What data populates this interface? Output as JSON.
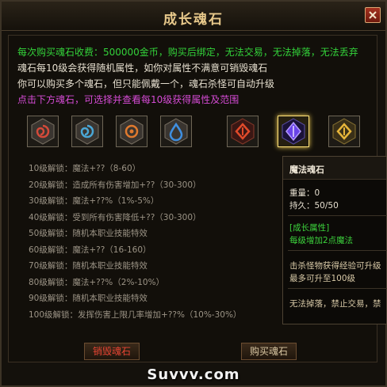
{
  "window": {
    "title": "成长魂石"
  },
  "info": {
    "line1": "每次购买魂石收费：500000金币，购买后绑定，无法交易，无法掉落，无法丢弃",
    "line2": "魂石每10级会获得随机属性，如你对属性不满意可销毁魂石",
    "line3": "你可以购买多个魂石，但只能佩戴一个，魂石杀怪可自动升级",
    "line4": "点击下方魂石，可选择并查看每10级获得属性及范围"
  },
  "stones": [
    {
      "icon": "red-swirl-rune-icon",
      "color": "#d44a3a"
    },
    {
      "icon": "blue-swirl-rune-icon",
      "color": "#4aa7d6"
    },
    {
      "icon": "orange-flame-rune-icon",
      "color": "#e07a2e"
    },
    {
      "icon": "blue-water-rune-icon",
      "color": "#3f8fe0"
    },
    {
      "icon": "red-crystal-rune-icon",
      "color": "#e04a2a"
    },
    {
      "icon": "purple-crystal-rune-icon",
      "color": "#8a5cff",
      "selected": true
    },
    {
      "icon": "gold-crystal-rune-icon",
      "color": "#e6b53a"
    }
  ],
  "levels": [
    "10级解锁：魔法+??（8-60）",
    "20级解锁：造成所有伤害增加+??（30-300）",
    "30级解锁：魔法+??%（1%-5%）",
    "40级解锁：受到所有伤害降低+??（30-300）",
    "50级解锁：随机本职业技能特效",
    "60级解锁：魔法+??（16-160）",
    "70级解锁：随机本职业技能特效",
    "80级解锁：魔法+??%（2%-10%）",
    "90级解锁：随机本职业技能特效",
    "100级解锁：发挥伤害上限几率增加+??%（10%-30%）"
  ],
  "buttons": {
    "destroy": "销毁魂石",
    "buy": "购买魂石"
  },
  "tooltip": {
    "name": "魔法魂石",
    "weight": "重量：0",
    "durability": "持久：50/50",
    "growth_title": "[成长属性]",
    "growth_desc": "每级增加2点魔法",
    "exp_line1": "击杀怪物获得经验可升级",
    "exp_line2": "最多可升至100级",
    "restriction": "无法掉落，禁止交易，禁"
  },
  "watermark": "Suvvv.com",
  "colors": {
    "green": "#33d23a",
    "purple": "#d54bd5",
    "gold": "#e8c98b",
    "destroy_text": "#e74433"
  }
}
